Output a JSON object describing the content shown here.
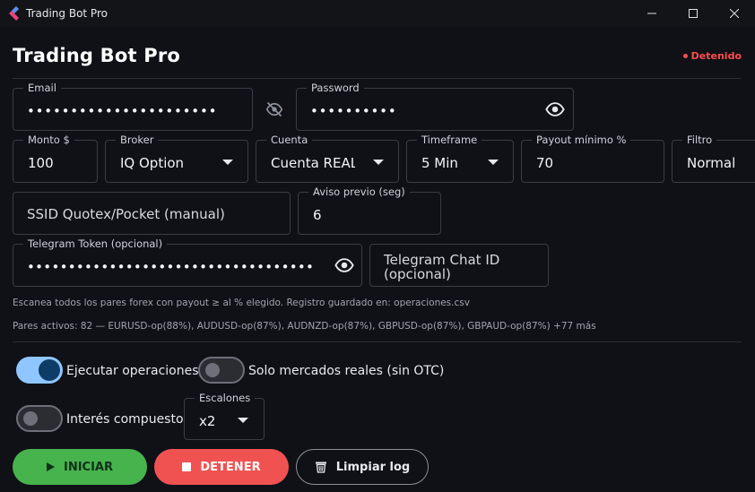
{
  "window": {
    "title": "Trading Bot Pro"
  },
  "header": {
    "title": "Trading Bot Pro",
    "status": "Detenido",
    "status_color": "#ff4d4d"
  },
  "credentials": {
    "email": {
      "label": "Email",
      "value": "••••••••••••••••••••••"
    },
    "password": {
      "label": "Password",
      "value": "••••••••••"
    }
  },
  "settings": {
    "monto": {
      "label": "Monto $",
      "value": "100"
    },
    "broker": {
      "label": "Broker",
      "value": "IQ Option"
    },
    "cuenta": {
      "label": "Cuenta",
      "value": "Cuenta REAL"
    },
    "timeframe": {
      "label": "Timeframe",
      "value": "5 Min"
    },
    "payout": {
      "label": "Payout mínimo %",
      "value": "70"
    },
    "filtro": {
      "label": "Filtro",
      "value": "Normal"
    }
  },
  "ssid": {
    "placeholder": "SSID Quotex/Pocket (manual)"
  },
  "aviso": {
    "label": "Aviso previo (seg)",
    "value": "6"
  },
  "telegram": {
    "token": {
      "label": "Telegram Token (opcional)",
      "value": "••••••••••••••••••••••••••••••••••••••••••••••"
    },
    "chat_id": {
      "placeholder": "Telegram Chat ID (opcional)"
    }
  },
  "info": {
    "scan_text": "Escanea todos los pares forex con payout ≥ al % elegido. Registro guardado en: operaciones.csv",
    "pairs_text": "Pares activos: 82 — EURUSD-op(88%), AUDUSD-op(87%), AUDNZD-op(87%), GBPUSD-op(87%), GBPAUD-op(87%) +77 más"
  },
  "toggles": {
    "ejecutar": {
      "label": "Ejecutar operaciones",
      "on": true
    },
    "solo_reales": {
      "label": "Solo mercados reales (sin OTC)",
      "on": false
    },
    "interes": {
      "label": "Interés compuesto",
      "on": false
    }
  },
  "escalones": {
    "label": "Escalones",
    "value": "x2"
  },
  "actions": {
    "start": "INICIAR",
    "stop": "DETENER",
    "clear": "Limpiar log"
  },
  "colors": {
    "accent": "#8fc6ff",
    "start": "#47b34d",
    "stop": "#f05252"
  }
}
